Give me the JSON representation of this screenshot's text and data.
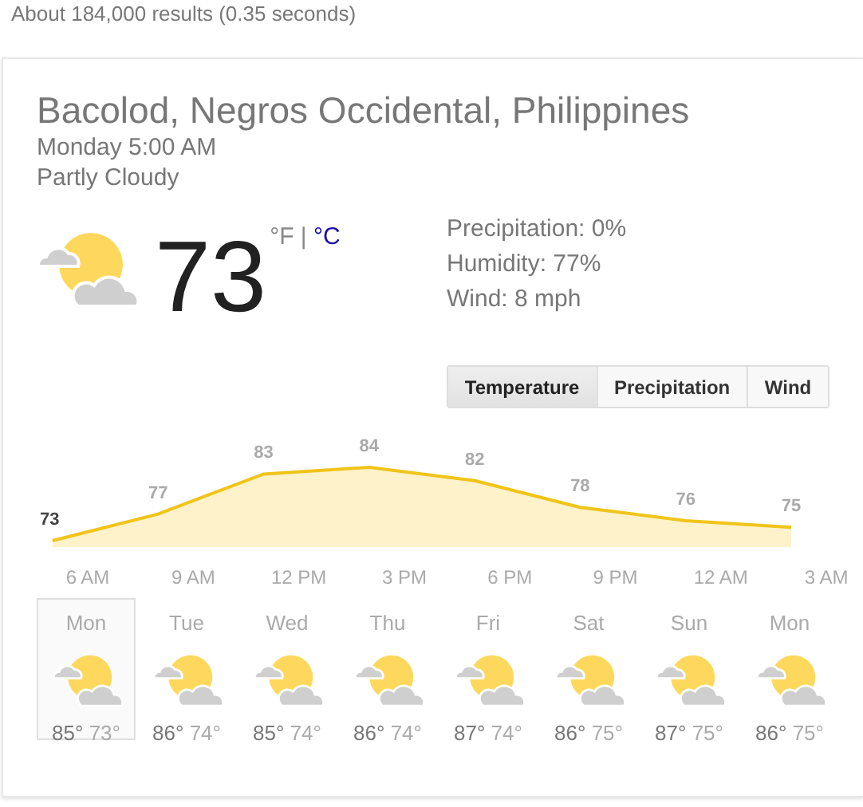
{
  "result_stats": "About 184,000 results (0.35 seconds)",
  "weather": {
    "location": "Bacolod, Negros Occidental, Philippines",
    "datetime": "Monday 5:00 AM",
    "condition": "Partly Cloudy",
    "temperature": "73",
    "units": [
      {
        "label": "°F",
        "selected": true
      },
      {
        "label": "°C",
        "selected": false
      }
    ],
    "unit_separator": "|",
    "details": [
      "Precipitation: 0%",
      "Humidity: 77%",
      "Wind: 8 mph"
    ],
    "tabs": [
      {
        "label": "Temperature",
        "selected": true
      },
      {
        "label": "Precipitation",
        "selected": false
      },
      {
        "label": "Wind",
        "selected": false
      }
    ],
    "chart_data": {
      "type": "area",
      "categories": [
        null,
        null,
        null,
        null,
        null,
        null,
        null,
        null
      ],
      "series": [
        {
          "color": "#f0c419",
          "values": [
            73,
            77,
            83,
            84,
            82,
            78,
            76,
            75
          ]
        }
      ],
      "data_labels": true
    },
    "hour_labels": [
      "6 AM",
      "9 AM",
      "12 PM",
      "3 PM",
      "6 PM",
      "9 PM",
      "12 AM",
      "3 AM"
    ],
    "forecast": [
      {
        "day": "Mon",
        "high": "85°",
        "low": "73°",
        "selected": true
      },
      {
        "day": "Tue",
        "high": "86°",
        "low": "74°",
        "selected": false
      },
      {
        "day": "Wed",
        "high": "85°",
        "low": "74°",
        "selected": false
      },
      {
        "day": "Thu",
        "high": "86°",
        "low": "74°",
        "selected": false
      },
      {
        "day": "Fri",
        "high": "87°",
        "low": "74°",
        "selected": false
      },
      {
        "day": "Sat",
        "high": "86°",
        "low": "75°",
        "selected": false
      },
      {
        "day": "Sun",
        "high": "87°",
        "low": "75°",
        "selected": false
      },
      {
        "day": "Mon",
        "high": "86°",
        "low": "75°",
        "selected": false
      }
    ]
  }
}
